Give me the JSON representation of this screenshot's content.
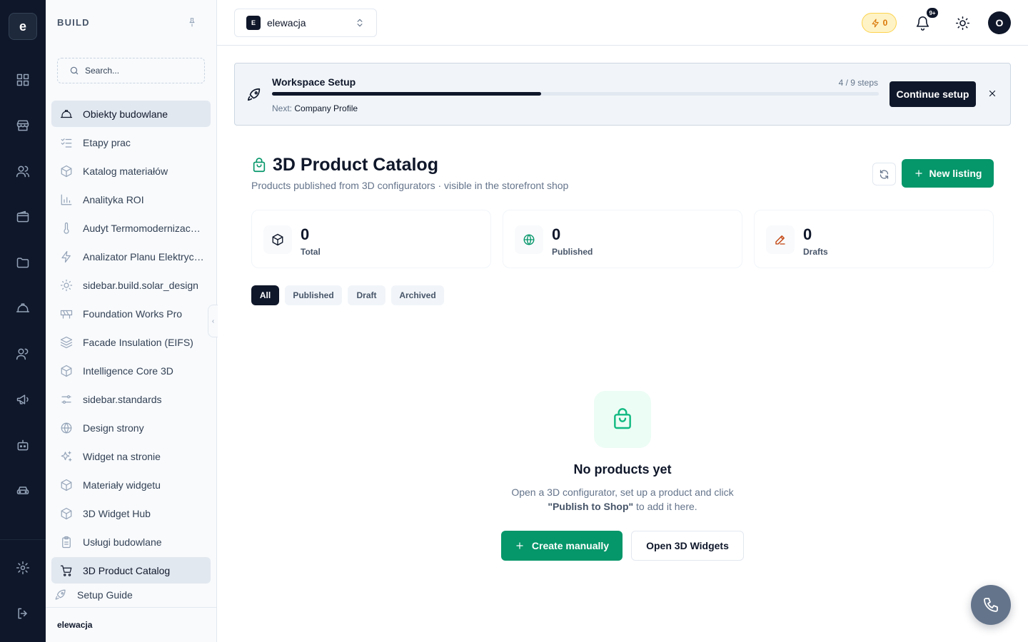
{
  "rail": {
    "logo": "e",
    "icons": [
      "dashboard-icon",
      "store-icon",
      "users-icon",
      "wallet-icon",
      "folder-icon",
      "helmet-icon",
      "team-icon",
      "megaphone-icon",
      "bot-icon",
      "car-icon",
      "settings-icon",
      "logout-icon"
    ]
  },
  "sidebar": {
    "heading": "BUILD",
    "search_placeholder": "Search...",
    "items": [
      {
        "label": "Obiekty budowlane",
        "icon": "helmet-icon"
      },
      {
        "label": "Etapy prac",
        "icon": "checklist-icon"
      },
      {
        "label": "Katalog materiałów",
        "icon": "box-icon"
      },
      {
        "label": "Analityka ROI",
        "icon": "bar-chart-icon"
      },
      {
        "label": "Audyt Termomodernizacyjny",
        "icon": "thermometer-icon"
      },
      {
        "label": "Analizator Planu Elektrycznego",
        "icon": "zap-icon"
      },
      {
        "label": "sidebar.build.solar_design",
        "icon": "sun-icon"
      },
      {
        "label": "Foundation Works Pro",
        "icon": "construction-icon"
      },
      {
        "label": "Facade Insulation (EIFS)",
        "icon": "layers-icon"
      },
      {
        "label": "Intelligence Core 3D",
        "icon": "box-icon"
      },
      {
        "label": "sidebar.standards",
        "icon": "sliders-icon"
      },
      {
        "label": "Design strony",
        "icon": "globe-icon"
      },
      {
        "label": "Widget na stronie",
        "icon": "sparkles-icon"
      },
      {
        "label": "Materiały widgetu",
        "icon": "box-icon"
      },
      {
        "label": "3D Widget Hub",
        "icon": "box-icon"
      },
      {
        "label": "Usługi budowlane",
        "icon": "clipboard-icon"
      },
      {
        "label": "3D Product Catalog",
        "icon": "cart-icon"
      },
      {
        "label": "Setup Guide",
        "icon": "rocket-icon"
      }
    ],
    "workspace_footer": "elewacja"
  },
  "topbar": {
    "workspace_badge": "E",
    "workspace_name": "elewacja",
    "credits": "0",
    "notifications_badge": "9+",
    "avatar_initial": "O"
  },
  "setup_banner": {
    "title": "Workspace Setup",
    "steps_text": "4 / 9 steps",
    "progress": 0.444,
    "next_label": "Next:",
    "next_value": "Company Profile",
    "continue_label": "Continue setup"
  },
  "page": {
    "title": "3D Product Catalog",
    "subtitle": "Products published from 3D configurators · visible in the storefront shop",
    "new_listing_label": "New listing"
  },
  "stats": [
    {
      "value": "0",
      "label": "Total",
      "icon": "box-icon",
      "color": "#0f172a"
    },
    {
      "value": "0",
      "label": "Published",
      "icon": "globe-icon",
      "color": "#059669"
    },
    {
      "value": "0",
      "label": "Drafts",
      "icon": "pencil-icon",
      "color": "#c2410c"
    }
  ],
  "filters": [
    "All",
    "Published",
    "Draft",
    "Archived"
  ],
  "empty_state": {
    "title": "No products yet",
    "line1": "Open a 3D configurator, set up a product and click",
    "highlight": "\"Publish to Shop\"",
    "line2_suffix": " to add it here.",
    "create_label": "Create manually",
    "open_label": "Open 3D Widgets"
  },
  "colors": {
    "accent": "#059669",
    "dark": "#0f172a",
    "muted": "#64748b"
  }
}
